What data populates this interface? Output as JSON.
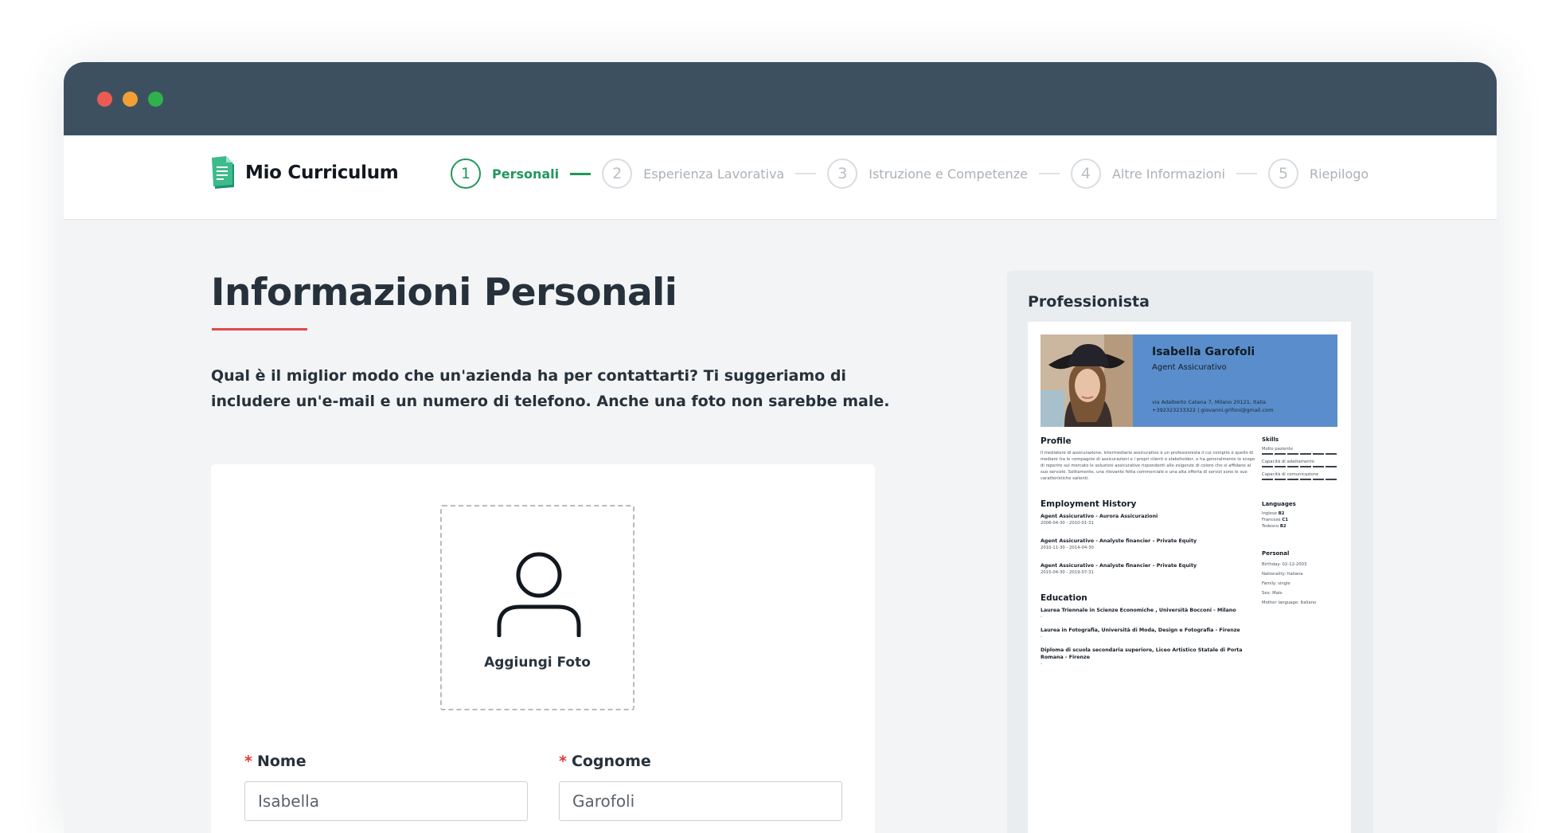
{
  "app": {
    "brand_name": "Mio Curriculum",
    "accent_color": "#22985a",
    "titlebar_color": "#3d5060"
  },
  "stepper": {
    "steps": [
      {
        "number": "1",
        "label": "Personali",
        "active": true
      },
      {
        "number": "2",
        "label": "Esperienza Lavorativa",
        "active": false
      },
      {
        "number": "3",
        "label": "Istruzione e Competenze",
        "active": false
      },
      {
        "number": "4",
        "label": "Altre Informazioni",
        "active": false
      },
      {
        "number": "5",
        "label": "Riepilogo",
        "active": false
      }
    ]
  },
  "main": {
    "title": "Informazioni Personali",
    "intro": "Qual è il miglior modo che un'azienda ha per contattarti? Ti suggeriamo di includere un'e-mail e un numero di telefono. Anche una foto non sarebbe male."
  },
  "form": {
    "photo_label": "Aggiungi Foto",
    "nome": {
      "label": "Nome",
      "required_marker": "*",
      "value": "Isabella"
    },
    "cognome": {
      "label": "Cognome",
      "required_marker": "*",
      "value": "Garofoli"
    }
  },
  "preview": {
    "template_name": "Professionista",
    "cv": {
      "name": "Isabella Garofoli",
      "role": "Agent Assicurativo",
      "address": "via Adalberto Catena 7, Milano 20121, Italia",
      "contact": "+392323233322 | giovanni.grifoni@gmail.com",
      "profile_heading": "Profile",
      "profile_text": "Il mediatore di assicurazione, intermediario assicurativo è un professionista il cui compito è quello di mediare tra le compagnie di assicurazioni e i propri clienti o stakeholder, e ha generalmente lo scopo di reperire sul mercato le soluzioni assicurative rispondenti alle esigenze di coloro che si affidano al suo servizio. Solitamente, una rilevante fetta commerciale e una alta offerta di servizi sono le sue caratteristiche salienti.",
      "employment_heading": "Employment History",
      "employment": [
        {
          "title": "Agent Assicurativo - Aurora Assicurazioni",
          "dates": "2006-04-30 - 2010-01-31"
        },
        {
          "title": "Agent Assicurativo - Analyste financier – Private Equity",
          "dates": "2010-11-30 - 2014-04-30"
        },
        {
          "title": "Agent Assicurativo - Analyste financier – Private Equity",
          "dates": "2015-04-30 - 2019-07-31"
        }
      ],
      "education_heading": "Education",
      "education": [
        {
          "title": "Laurea Triennale in Scienze Economiche , Università Bocconi - Milano",
          "dates": "-"
        },
        {
          "title": "Laurea in Fotografia, Università di Moda, Design e Fotografia - Firenze",
          "dates": "-"
        },
        {
          "title": "Diploma di scuola secondaria superiore, Liceo Artistico Statale di Porta Romana - Firenze",
          "dates": "-"
        }
      ],
      "skills_heading": "Skills",
      "skills": [
        "Molto paziente",
        "Capacità di adattamento",
        "Capacità di comunicazione"
      ],
      "languages_heading": "Languages",
      "languages": [
        {
          "name": "Inglese",
          "level": "B2"
        },
        {
          "name": "Francese",
          "level": "C1"
        },
        {
          "name": "Tedesco",
          "level": "B2"
        }
      ],
      "personal_heading": "Personal",
      "personal": [
        "Birthday: 02-12-2003",
        "Nationality: Italiana",
        "Family: single",
        "Sex: Male",
        "Mother language: Italiano"
      ]
    }
  }
}
